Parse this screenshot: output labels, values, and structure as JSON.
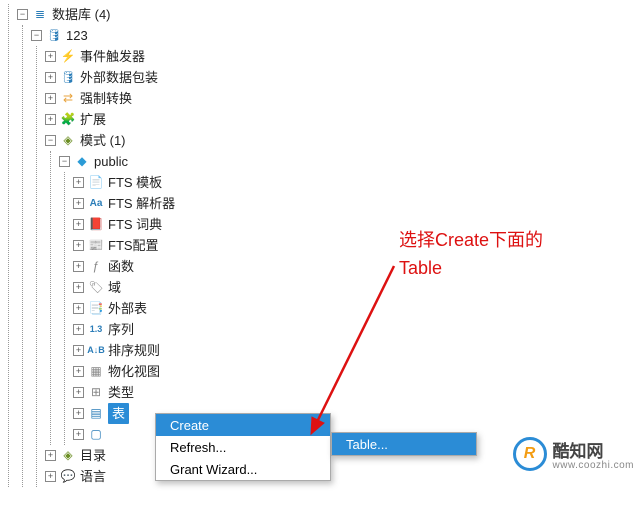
{
  "tree": {
    "root": {
      "label": "数据库 (4)"
    },
    "db": {
      "label": "123"
    },
    "items": [
      {
        "label": "事件触发器"
      },
      {
        "label": "外部数据包装"
      },
      {
        "label": "强制转换"
      },
      {
        "label": "扩展"
      }
    ],
    "schema": {
      "label": "模式 (1)"
    },
    "public": {
      "label": "public"
    },
    "pubitems": [
      {
        "label": "FTS 模板"
      },
      {
        "label": "FTS 解析器"
      },
      {
        "label": "FTS 词典"
      },
      {
        "label": "FTS配置"
      },
      {
        "label": "函数"
      },
      {
        "label": "域"
      },
      {
        "label": "外部表"
      },
      {
        "label": "序列"
      },
      {
        "label": "排序规则"
      },
      {
        "label": "物化视图"
      },
      {
        "label": "类型"
      },
      {
        "label": "表"
      }
    ],
    "bottom": [
      {
        "label": "目录"
      },
      {
        "label": "语言"
      }
    ]
  },
  "menu1": {
    "create": "Create",
    "refresh": "Refresh...",
    "grant": "Grant Wizard..."
  },
  "menu2": {
    "table": "Table..."
  },
  "annotation": {
    "line1": "选择Create下面的",
    "line2": "Table"
  },
  "logo": {
    "name": "酷知网",
    "url": "www.coozhi.com",
    "mark": "R"
  }
}
